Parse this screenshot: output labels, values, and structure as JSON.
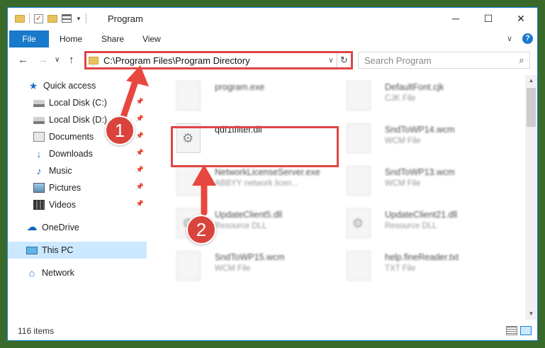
{
  "window": {
    "title": "Program",
    "controls": {
      "minimize": "─",
      "maximize": "☐",
      "close": "✕"
    }
  },
  "ribbon": {
    "tabs": [
      "File",
      "Home",
      "Share",
      "View"
    ],
    "expand": "∨",
    "help": "?"
  },
  "navigation": {
    "back": "←",
    "forward": "→",
    "recent": "∨",
    "up": "↑",
    "address": "C:\\Program Files\\Program Directory",
    "address_dropdown": "∨",
    "refresh": "↻",
    "search_placeholder": "Search Program",
    "search_icon": "⌕"
  },
  "sidebar": {
    "items": [
      {
        "label": "Quick access",
        "icon": "star-icon",
        "pinned": false
      },
      {
        "label": "Local Disk (C:)",
        "icon": "disk-icon",
        "pinned": true
      },
      {
        "label": "Local Disk (D:)",
        "icon": "disk-icon",
        "pinned": true
      },
      {
        "label": "Documents",
        "icon": "documents-icon",
        "pinned": true
      },
      {
        "label": "Downloads",
        "icon": "downloads-icon",
        "pinned": true
      },
      {
        "label": "Music",
        "icon": "music-icon",
        "pinned": true
      },
      {
        "label": "Pictures",
        "icon": "pictures-icon",
        "pinned": true
      },
      {
        "label": "Videos",
        "icon": "videos-icon",
        "pinned": true
      },
      {
        "label": "OneDrive",
        "icon": "cloud-icon",
        "pinned": false
      },
      {
        "label": "This PC",
        "icon": "pc-icon",
        "pinned": false,
        "selected": true
      },
      {
        "label": "Network",
        "icon": "network-icon",
        "pinned": false
      }
    ]
  },
  "files": {
    "left": [
      {
        "name": "program.exe",
        "type": "",
        "blurred": true
      },
      {
        "name": "qdf1tfilter.dll",
        "type": "",
        "blurred": false,
        "highlighted": true
      },
      {
        "name": "NetworkLicenseServer.exe",
        "type": "ABBYY network licen...",
        "blurred": true
      },
      {
        "name": "UpdateClient5.dll",
        "type": "Resource DLL",
        "blurred": true
      },
      {
        "name": "SndToWP15.wcm",
        "type": "WCM File",
        "blurred": true
      }
    ],
    "right": [
      {
        "name": "DefaultFont.cjk",
        "type": "CJK File",
        "blurred": true
      },
      {
        "name": "SndToWP14.wcm",
        "type": "WCM File",
        "blurred": true
      },
      {
        "name": "SndToWP13.wcm",
        "type": "WCM File",
        "blurred": true
      },
      {
        "name": "UpdateClient21.dll",
        "type": "Resource DLL",
        "blurred": true
      },
      {
        "name": "help.fineReader.txt",
        "type": "TXT File",
        "blurred": true
      }
    ]
  },
  "scrollbar": {
    "up": "▲",
    "down": "▼"
  },
  "status": {
    "item_count": "116 items"
  },
  "annotations": {
    "step1": "1",
    "step2": "2"
  },
  "colors": {
    "accent": "#1979ca",
    "highlight": "#e04545",
    "badge": "#d9443c",
    "selected": "#cce8ff"
  }
}
